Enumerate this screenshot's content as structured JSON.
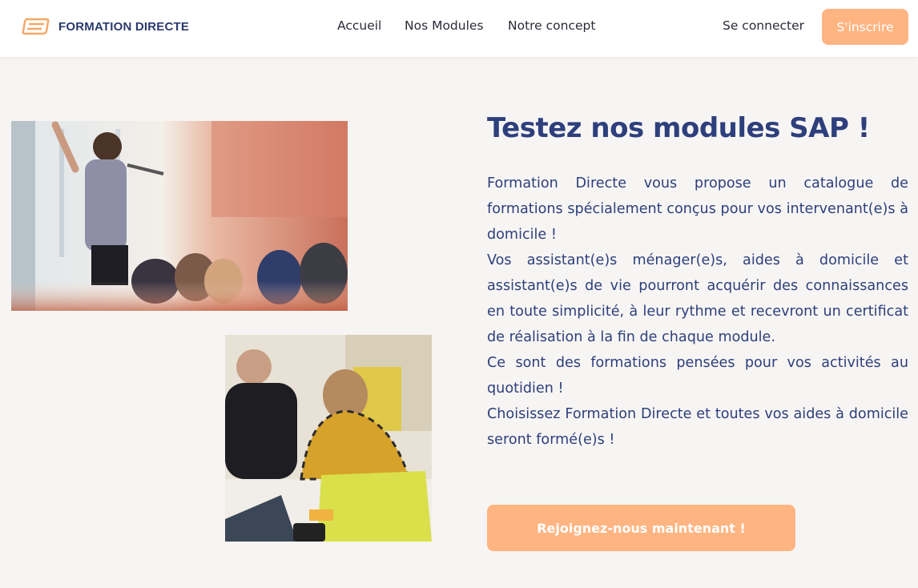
{
  "header": {
    "brand": "FORMATION DIRECTE",
    "logo_icon": "formation-directe-logo-mark",
    "nav": {
      "home": "Accueil",
      "modules": "Nos Modules",
      "concept": "Notre concept"
    },
    "login_label": "Se connecter",
    "signup_label": "S'inscrire"
  },
  "main": {
    "title": "Testez nos modules SAP !",
    "paragraphs": [
      "Formation Directe vous propose un catalogue de formations spécialement conçus pour vos intervenant(e)s à domicile !",
      "Vos assistant(e)s ménager(e)s, aides à domicile et assistant(e)s de vie pourront acquérir des connaissances en toute simplicité, à leur rythme et recevront un certificat de réalisation à la fin de chaque module.",
      "Ce sont des formations pensées pour vos activités au quotidien !",
      "Choisissez Formation Directe et toutes vos aides à domicile seront formé(e)s !"
    ],
    "cta_label": "Rejoignez-nous maintenant !"
  },
  "colors": {
    "accent": "#ffb582",
    "heading": "#2d3f7c",
    "brand_text": "#2b3a6e",
    "background": "#f7f5f3"
  }
}
